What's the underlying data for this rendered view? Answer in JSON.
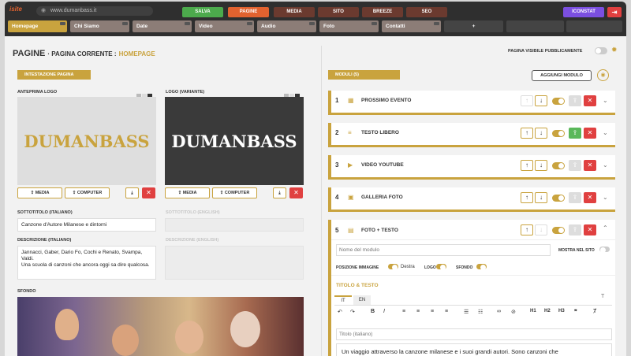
{
  "topbar": {
    "logo": "isite",
    "url": "www.dumanbass.it",
    "buttons": [
      {
        "label": "SALVA",
        "color": "#4caa4c"
      },
      {
        "label": "PAGINE",
        "color": "#e2622f"
      },
      {
        "label": "MEDIA",
        "color": "#6b3a2f"
      },
      {
        "label": "SITO",
        "color": "#6b3a2f"
      },
      {
        "label": "BREEZE",
        "color": "#6b3a2f"
      },
      {
        "label": "SEO",
        "color": "#6b3a2f"
      }
    ],
    "iconstat": "ICONSTAT",
    "logout_icon": "logout-icon"
  },
  "nav": {
    "tabs": [
      "Homepage",
      "Chi Siamo",
      "Date",
      "Video",
      "Audio",
      "Foto",
      "Contatti",
      "+",
      "",
      ""
    ]
  },
  "header": {
    "title": "PAGINE",
    "subtitle": "· PAGINA CORRENTE :",
    "page": "HOMEPAGE",
    "visibility_label": "PAGINA VISIBILE PUBBLICAMENTE"
  },
  "left": {
    "section_button": "INTESTAZIONE PAGINA",
    "logo_label": "ANTEPRIMA LOGO",
    "logo_variant_label": "LOGO (VARIANTE)",
    "logo_text": "DUMANBASS",
    "logo_variant_text": "DUMANBASS",
    "media_label": "MEDIA",
    "computer_label": "COMPUTER",
    "subtitle_it_label": "SOTTOTITOLO (ITALIANO)",
    "subtitle_it_value": "Canzone d'Autore Milanese e dintorni",
    "subtitle_en_label": "SOTTOTITOLO (ENGLISH)",
    "desc_it_label": "DESCRIZIONE (ITALIANO)",
    "desc_it_value": "Jannacci, Gaber, Dario Fo, Cochi e Renato, Svampa, Valdi.\nUna scuola di canzoni che ancora oggi sa dire qualcosa.",
    "desc_en_label": "DESCRIZIONE (ENGLISH)",
    "background_label": "SFONDO"
  },
  "right": {
    "section_button": "MODULI (5)",
    "add_button": "AGGIUNGI MODULO",
    "modules": [
      {
        "num": "1",
        "icon": "calendar-icon",
        "title": "PROSSIMO EVENTO"
      },
      {
        "num": "2",
        "icon": "text-icon",
        "title": "TESTO LIBERO"
      },
      {
        "num": "3",
        "icon": "youtube-icon",
        "title": "VIDEO YOUTUBE"
      },
      {
        "num": "4",
        "icon": "gallery-icon",
        "title": "GALLERIA FOTO"
      },
      {
        "num": "5",
        "icon": "photo-text-icon",
        "title": "FOTO + TESTO"
      }
    ],
    "module5": {
      "name_placeholder": "Nome del modulo",
      "show_on_site": "MOSTRA NEL SITO",
      "img_position_label": "POSIZIONE IMMAGINE",
      "img_position_value": "Destra",
      "logo_label": "LOGO",
      "background_label": "SFONDO",
      "title_text_label": "TITOLO & TESTO",
      "lang_tabs": [
        "IT",
        "EN"
      ],
      "title_placeholder": "Titolo (italiano)",
      "body_text": "Un viaggio attraverso la canzone milanese e i suoi grandi autori. Sono canzoni che",
      "toolbar": [
        "↶",
        "↷",
        "B",
        "I",
        "≡",
        "≡",
        "≡",
        "≡",
        "•",
        "1.",
        "🔗",
        "⊘",
        "H1",
        "H2",
        "H3",
        "❞",
        "Tx"
      ]
    }
  }
}
